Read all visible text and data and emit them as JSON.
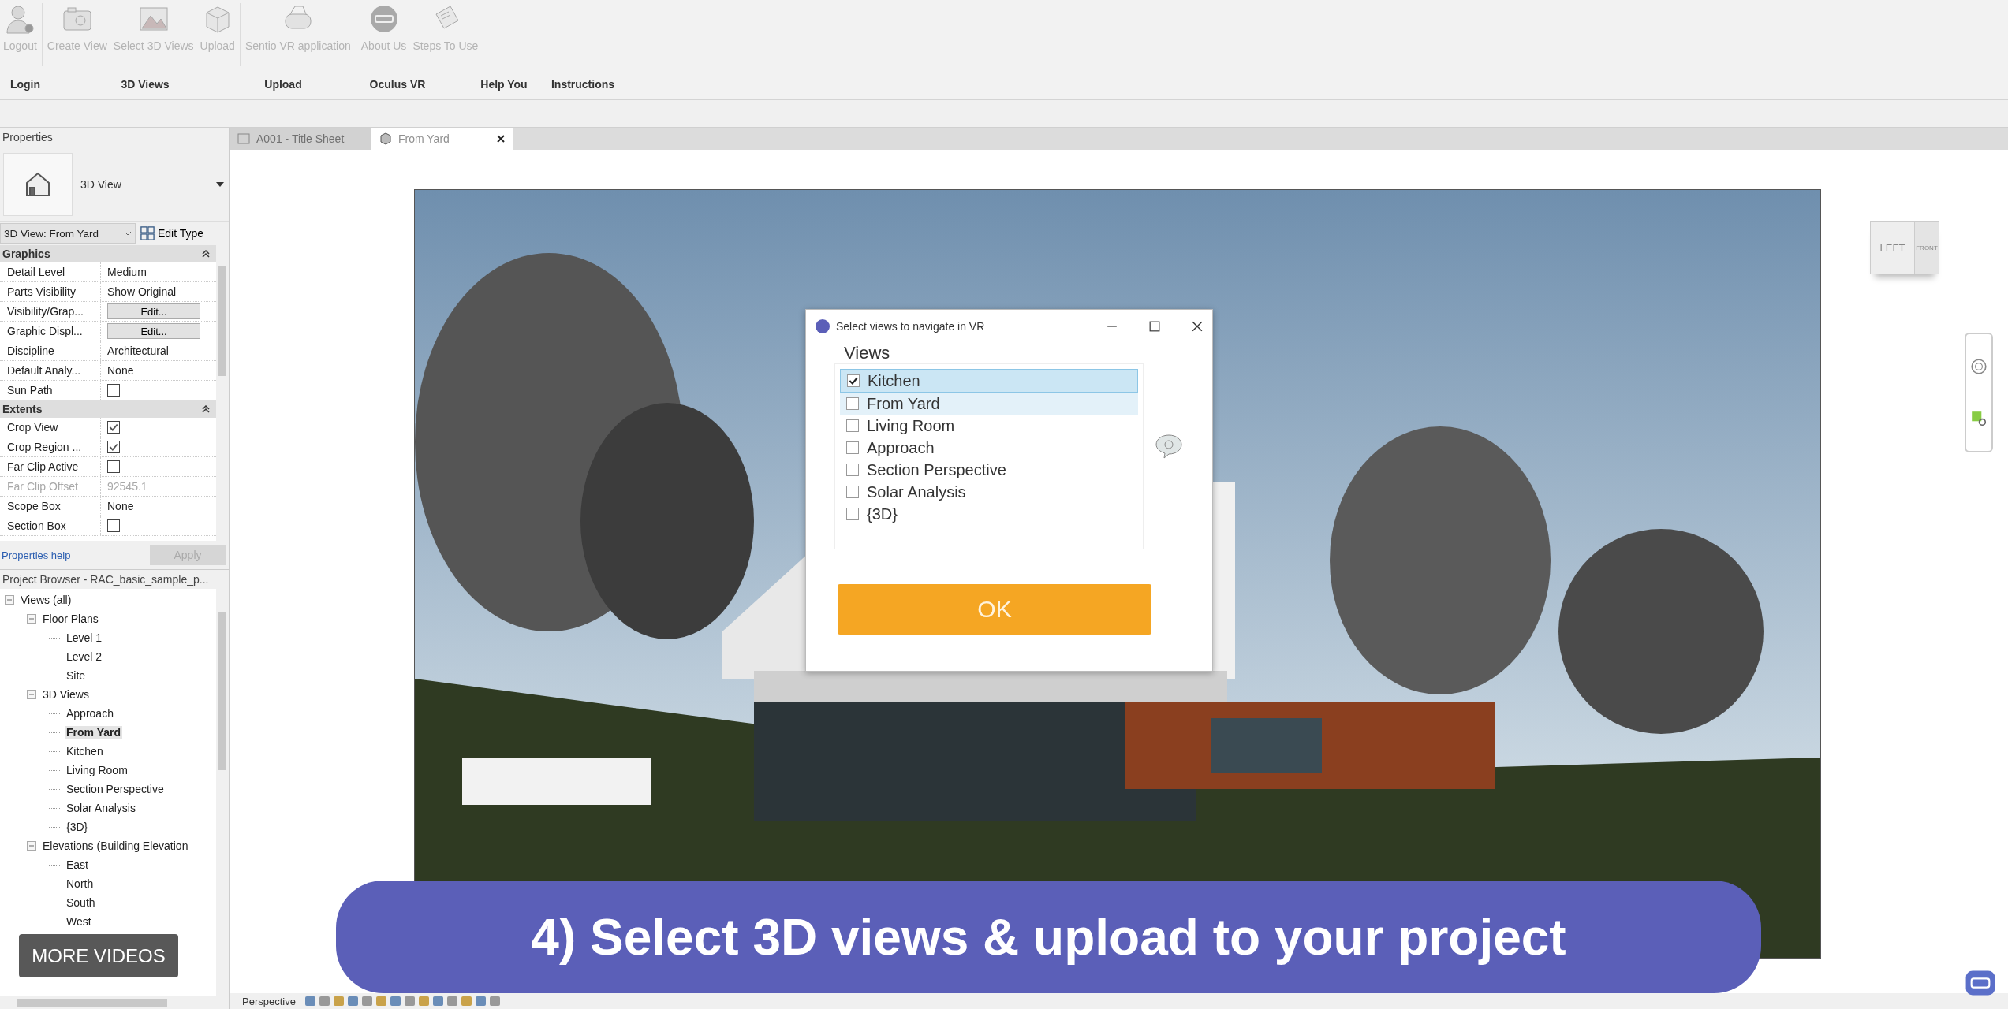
{
  "ribbon": {
    "buttons": [
      {
        "label": "Logout",
        "disabled": true
      },
      {
        "label": "Create View",
        "disabled": true
      },
      {
        "label": "Select 3D Views",
        "disabled": true
      },
      {
        "label": "Upload",
        "disabled": true
      },
      {
        "label": "Sentio VR application",
        "disabled": true
      },
      {
        "label": "About Us",
        "disabled": true
      },
      {
        "label": "Steps To Use",
        "disabled": true
      }
    ],
    "groups": [
      {
        "label": "Login"
      },
      {
        "label": "3D Views"
      },
      {
        "label": "Upload"
      },
      {
        "label": "Oculus VR"
      },
      {
        "label": "Help You"
      },
      {
        "label": "Instructions"
      }
    ]
  },
  "properties": {
    "title": "Properties",
    "type_name": "3D View",
    "instance": "3D View: From Yard",
    "edit_type": "Edit Type",
    "sections": [
      {
        "title": "Graphics",
        "rows": [
          {
            "label": "Detail Level",
            "kind": "text",
            "value": "Medium",
            "disabled": false
          },
          {
            "label": "Parts Visibility",
            "kind": "text",
            "value": "Show Original",
            "disabled": false
          },
          {
            "label": "Visibility/Grap...",
            "kind": "button",
            "value": "Edit...",
            "disabled": false
          },
          {
            "label": "Graphic Displ...",
            "kind": "button",
            "value": "Edit...",
            "disabled": false
          },
          {
            "label": "Discipline",
            "kind": "text",
            "value": "Architectural",
            "disabled": false
          },
          {
            "label": "Default Analy...",
            "kind": "text",
            "value": "None",
            "disabled": false
          },
          {
            "label": "Sun Path",
            "kind": "checkbox",
            "checked": false,
            "disabled": false
          }
        ]
      },
      {
        "title": "Extents",
        "rows": [
          {
            "label": "Crop View",
            "kind": "checkbox",
            "checked": true,
            "disabled": false
          },
          {
            "label": "Crop Region ...",
            "kind": "checkbox",
            "checked": true,
            "disabled": false
          },
          {
            "label": "Far Clip Active",
            "kind": "checkbox",
            "checked": false,
            "disabled": false
          },
          {
            "label": "Far Clip Offset",
            "kind": "text",
            "value": "92545.1",
            "disabled": true
          },
          {
            "label": "Scope Box",
            "kind": "text",
            "value": "None",
            "disabled": false
          },
          {
            "label": "Section Box",
            "kind": "checkbox",
            "checked": false,
            "disabled": false
          }
        ]
      }
    ],
    "help_link": "Properties help",
    "apply": {
      "label": "Apply",
      "disabled": true
    }
  },
  "project_browser": {
    "title": "Project Browser - RAC_basic_sample_p...",
    "tree": [
      {
        "label": "Views (all)",
        "expanded": true,
        "selected": false,
        "children": [
          {
            "label": "Floor Plans",
            "expanded": true,
            "selected": false,
            "children": [
              {
                "label": "Level 1",
                "selected": false
              },
              {
                "label": "Level 2",
                "selected": false
              },
              {
                "label": "Site",
                "selected": false
              }
            ]
          },
          {
            "label": "3D Views",
            "expanded": true,
            "selected": false,
            "children": [
              {
                "label": "Approach",
                "selected": false
              },
              {
                "label": "From Yard",
                "selected": true
              },
              {
                "label": "Kitchen",
                "selected": false
              },
              {
                "label": "Living Room",
                "selected": false
              },
              {
                "label": "Section Perspective",
                "selected": false
              },
              {
                "label": "Solar Analysis",
                "selected": false
              },
              {
                "label": "{3D}",
                "selected": false
              }
            ]
          },
          {
            "label": "Elevations (Building Elevation",
            "expanded": true,
            "selected": false,
            "children": [
              {
                "label": "East",
                "selected": false
              },
              {
                "label": "North",
                "selected": false
              },
              {
                "label": "South",
                "selected": false
              },
              {
                "label": "West",
                "selected": false
              }
            ]
          }
        ]
      }
    ]
  },
  "tabs": [
    {
      "label": "A001 - Title Sheet",
      "selected": false
    },
    {
      "label": "From Yard",
      "selected": true
    }
  ],
  "view_cube": {
    "left": "LEFT",
    "front": "FRONT"
  },
  "dialog": {
    "title": "Select views to navigate in VR",
    "group_label": "Views",
    "items": [
      {
        "label": "Kitchen",
        "checked": true,
        "selected": true,
        "hovered": false
      },
      {
        "label": "From Yard",
        "checked": false,
        "selected": false,
        "hovered": true
      },
      {
        "label": "Living Room",
        "checked": false,
        "selected": false,
        "hovered": false
      },
      {
        "label": "Approach",
        "checked": false,
        "selected": false,
        "hovered": false
      },
      {
        "label": "Section Perspective",
        "checked": false,
        "selected": false,
        "hovered": false
      },
      {
        "label": "Solar Analysis",
        "checked": false,
        "selected": false,
        "hovered": false
      },
      {
        "label": "{3D}",
        "checked": false,
        "selected": false,
        "hovered": false
      }
    ],
    "ok": "OK"
  },
  "banner": "4) Select 3D views & upload to your project",
  "more_videos": "MORE VIDEOS",
  "status_bar": {
    "view_mode": "Perspective"
  }
}
